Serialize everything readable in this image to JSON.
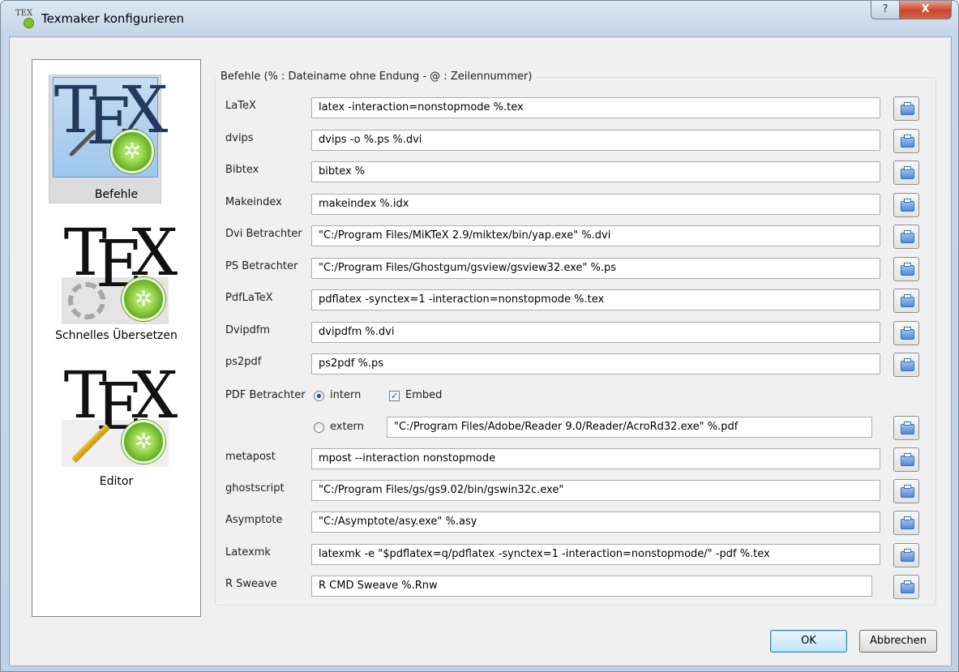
{
  "window": {
    "title": "Texmaker konfigurieren",
    "help_glyph": "?",
    "close_glyph": "X"
  },
  "pages": [
    {
      "label": "Befehle",
      "selected": true,
      "icon": "tex-tools-gear-icon",
      "logo": {
        "t": "T",
        "e": "E",
        "x": "X"
      }
    },
    {
      "label": "Schnelles Übersetzen",
      "selected": false,
      "icon": "tex-gears-icon",
      "logo": {
        "t": "T",
        "e": "E",
        "x": "X"
      }
    },
    {
      "label": "Editor",
      "selected": false,
      "icon": "tex-pencil-gear-icon",
      "logo": {
        "t": "T",
        "e": "E",
        "x": "X"
      }
    }
  ],
  "group": {
    "title": "Befehle (% : Dateiname ohne Endung - @ : Zeilennummer)"
  },
  "commands": {
    "latex": {
      "label": "LaTeX",
      "value": "latex -interaction=nonstopmode %.tex"
    },
    "dvips": {
      "label": "dvips",
      "value": "dvips -o %.ps %.dvi"
    },
    "bibtex": {
      "label": "Bibtex",
      "value": "bibtex %"
    },
    "makeindex": {
      "label": "Makeindex",
      "value": "makeindex %.idx"
    },
    "dvi_viewer": {
      "label": "Dvi Betrachter",
      "value": "\"C:/Program Files/MiKTeX 2.9/miktex/bin/yap.exe\" %.dvi"
    },
    "ps_viewer": {
      "label": "PS Betrachter",
      "value": "\"C:/Program Files/Ghostgum/gsview/gsview32.exe\" %.ps"
    },
    "pdflatex": {
      "label": "PdfLaTeX",
      "value": "pdflatex -synctex=1 -interaction=nonstopmode %.tex"
    },
    "dvipdfm": {
      "label": "Dvipdfm",
      "value": "dvipdfm %.dvi"
    },
    "ps2pdf": {
      "label": "ps2pdf",
      "value": "ps2pdf %.ps"
    },
    "metapost": {
      "label": "metapost",
      "value": "mpost --interaction nonstopmode"
    },
    "ghostscript": {
      "label": "ghostscript",
      "value": "\"C:/Program Files/gs/gs9.02/bin/gswin32c.exe\""
    },
    "asymptote": {
      "label": "Asymptote",
      "value": "\"C:/Asymptote/asy.exe\" %.asy"
    },
    "latexmk": {
      "label": "Latexmk",
      "value": "latexmk -e \"$pdflatex=q/pdflatex -synctex=1 -interaction=nonstopmode/\" -pdf %.tex"
    },
    "rsweave": {
      "label": "R Sweave",
      "value": "R CMD Sweave %.Rnw"
    }
  },
  "pdf_viewer": {
    "label": "PDF Betrachter",
    "intern_label": "intern",
    "intern_selected": true,
    "embed_label": "Embed",
    "embed_checked": true,
    "extern_label": "extern",
    "extern_selected": false,
    "extern_value": "\"C:/Program Files/Adobe/Reader 9.0/Reader/AcroRd32.exe\" %.pdf",
    "check_glyph": "✓"
  },
  "buttons": {
    "ok": "OK",
    "cancel": "Abbrechen"
  },
  "icons": {
    "file_picker": "open-folder-icon"
  }
}
